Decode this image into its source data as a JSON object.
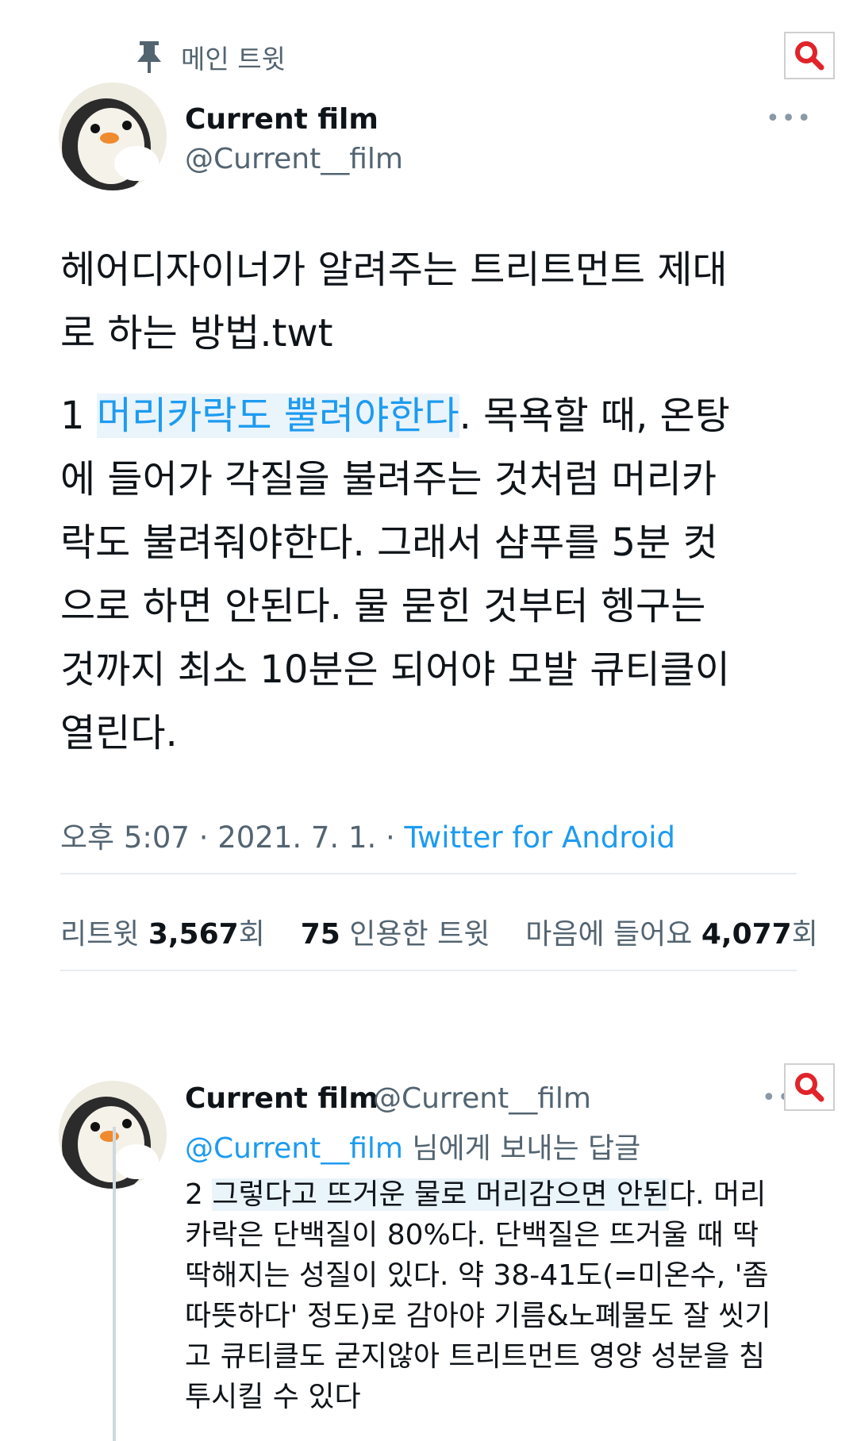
{
  "colors": {
    "accent": "#1d9bf0",
    "secondary": "#536471",
    "highlight": "#eaf4fb",
    "zoom_icon": "#e0242a"
  },
  "pinned": {
    "icon": "pin-icon",
    "label": "메인 트윗"
  },
  "tweet": {
    "author": {
      "name": "Current film",
      "handle": "@Current__film"
    },
    "more_icon": "more-horizontal-icon",
    "title_lines": [
      "헤어디자이너가 알려주는 트리트먼트 제대",
      "로 하는 방법.twt"
    ],
    "body": {
      "line1_prefix": "1 ",
      "line1_highlight": "머리카락도 뿔려야한다",
      "line1_suffix": ". 목욕할 때, 온탕",
      "lines": [
        "에 들어가 각질을 불려주는 것처럼 머리카",
        "락도 불려줘야한다. 그래서 샴푸를 5분 컷",
        "으로 하면 안된다. 물 묻힌 것부터 헹구는",
        "것까지 최소 10분은 되어야 모발 큐티클이",
        "열린다."
      ]
    },
    "time": "오후 5:07 · 2021. 7. 1. · ",
    "source": "Twitter for Android",
    "stats": {
      "retweets_label": "리트윗 ",
      "retweets": "3,567",
      "retweets_suffix": "회",
      "quotes": "75",
      "quotes_label": " 인용한 트윗",
      "likes_label": "마음에 들어요 ",
      "likes": "4,077",
      "likes_suffix": "회"
    }
  },
  "reply": {
    "author": {
      "name": "Current film",
      "handle": "@Current__film"
    },
    "more_icon": "more-horizontal-icon",
    "replying_mention": "@Current__film",
    "replying_suffix": " 님에게 보내는 답글",
    "text": {
      "line1_prefix": "2 ",
      "line1_highlight": "그렇다고 뜨거운 물로 머리감으면 안된",
      "line1_suffix": "다. 머리",
      "lines": [
        "카락은 단백질이 80%다. 단백질은 뜨거울 때 딱",
        "딱해지는 성질이 있다. 약 38-41도(=미온수, '좀",
        "따뜻하다' 정도)로 감아야 기름&노폐물도 잘 씻기",
        "고 큐티클도 굳지않아 트리트먼트 영양 성분을 침",
        "투시킬 수 있다"
      ]
    }
  },
  "zoom_icon": "search-zoom-icon"
}
